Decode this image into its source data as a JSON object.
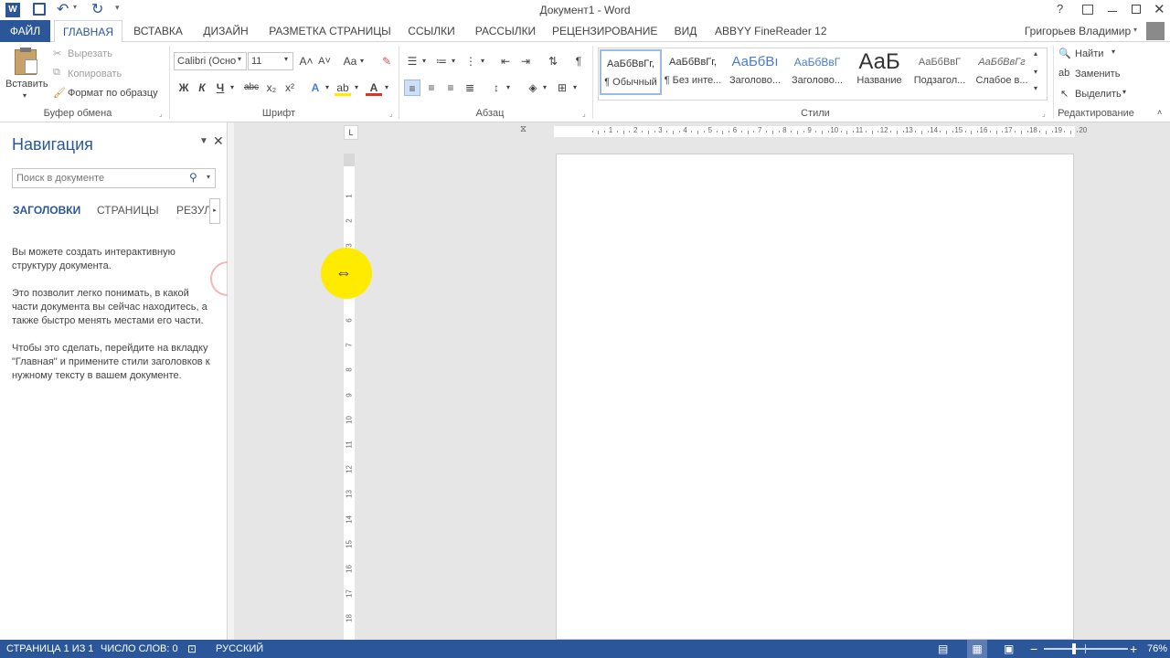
{
  "title_bar": {
    "doc_title": "Документ1 - Word",
    "app_icon": "word-icon",
    "quick_access": [
      "save-icon",
      "undo-icon",
      "redo-icon",
      "customize-icon"
    ],
    "window_controls": [
      "help-icon",
      "ribbon-display-icon",
      "minimize-icon",
      "restore-icon",
      "close-icon"
    ]
  },
  "tabs": {
    "file": "ФАЙЛ",
    "items": [
      "ГЛАВНАЯ",
      "ВСТАВКА",
      "ДИЗАЙН",
      "РАЗМЕТКА СТРАНИЦЫ",
      "ССЫЛКИ",
      "РАССЫЛКИ",
      "РЕЦЕНЗИРОВАНИЕ",
      "ВИД",
      "ABBYY FineReader 12"
    ],
    "active": "ГЛАВНАЯ",
    "user": "Григорьев Владимир"
  },
  "ribbon": {
    "clipboard": {
      "paste": "Вставить",
      "cut": "Вырезать",
      "copy": "Копировать",
      "format_painter": "Формат по образцу",
      "label": "Буфер обмена"
    },
    "font": {
      "font_name": "Calibri (Осно",
      "font_size": "11",
      "bold": "Ж",
      "italic": "К",
      "underline": "Ч",
      "strike": "abc",
      "subscript": "x₂",
      "superscript": "x²",
      "change_case": "Aa",
      "label": "Шрифт"
    },
    "paragraph": {
      "label": "Абзац"
    },
    "styles": {
      "items": [
        {
          "preview": "АаБбВвГг,",
          "name": "¶ Обычный"
        },
        {
          "preview": "АаБбВвГг,",
          "name": "¶ Без инте..."
        },
        {
          "preview": "АаБбВı",
          "name": "Заголово..."
        },
        {
          "preview": "АаБбВвГ",
          "name": "Заголово..."
        },
        {
          "preview": "АаБ",
          "name": "Название"
        },
        {
          "preview": "АаБбВвГ",
          "name": "Подзагол..."
        },
        {
          "preview": "АаБбВвГг",
          "name": "Слабое в..."
        }
      ],
      "label": "Стили"
    },
    "editing": {
      "find": "Найти",
      "replace": "Заменить",
      "select": "Выделить",
      "label": "Редактирование"
    }
  },
  "nav": {
    "title": "Навигация",
    "search_placeholder": "Поиск в документе",
    "tabs": [
      "ЗАГОЛОВКИ",
      "СТРАНИЦЫ",
      "РЕЗУЛЬ"
    ],
    "p1": "Вы можете создать интерактивную структуру документа.",
    "p2": "Это позволит легко понимать, в какой части документа вы сейчас находитесь, а также быстро менять местами его части.",
    "p3": "Чтобы это сделать, перейдите на вкладку \"Главная\" и примените стили заголовков к нужному тексту в вашем документе."
  },
  "ruler": {
    "h_ticks": [
      "1",
      "2",
      "3",
      "4",
      "5",
      "6",
      "7",
      "8",
      "9",
      "10",
      "11",
      "12",
      "13",
      "14",
      "15",
      "16",
      "17",
      "18",
      "19",
      "20"
    ],
    "v_ticks": [
      "1",
      "2",
      "3",
      "4",
      "5",
      "6",
      "7",
      "8",
      "9",
      "10",
      "11",
      "12",
      "13",
      "14",
      "15",
      "16",
      "17",
      "18",
      "19"
    ]
  },
  "status": {
    "page": "СТРАНИЦА 1 ИЗ 1",
    "words": "ЧИСЛО СЛОВ: 0",
    "language": "РУССКИЙ",
    "zoom": "76%",
    "zoom_level": 0.76
  },
  "colors": {
    "accent": "#2b579a",
    "cursor_highlight": "#ffeb00",
    "click_ring": "#f3b7b7"
  }
}
